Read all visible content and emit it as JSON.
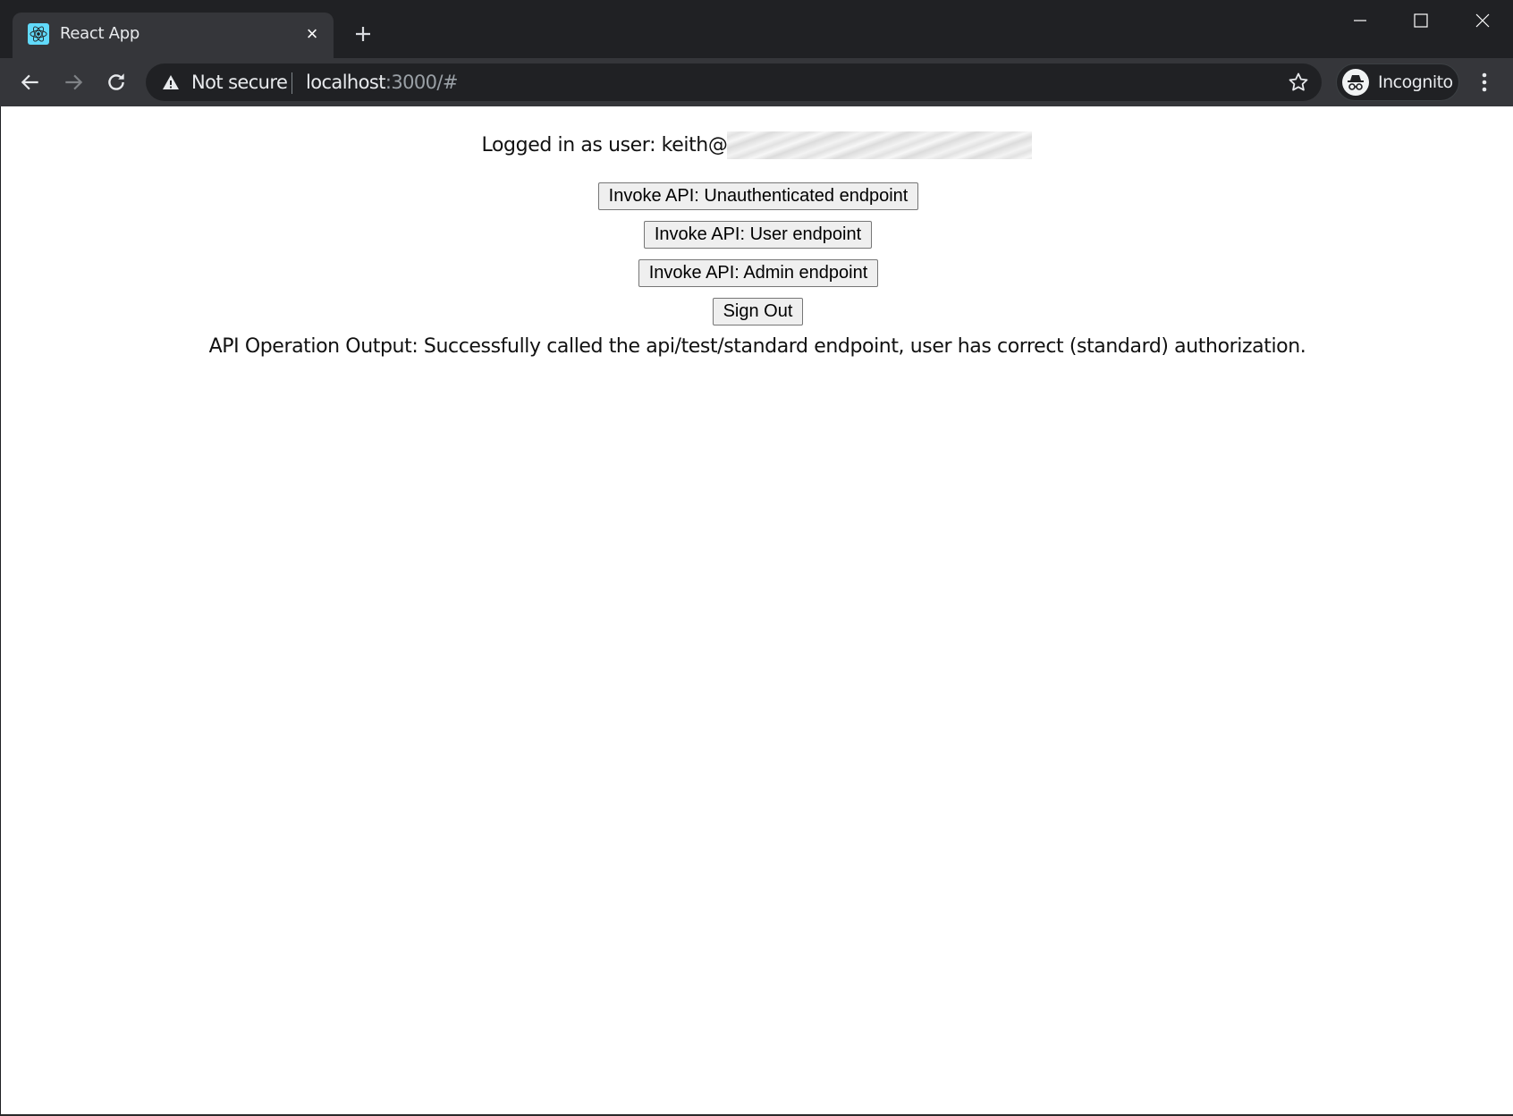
{
  "browser": {
    "tab": {
      "title": "React App",
      "favicon": "react-logo-icon",
      "close": "×"
    },
    "new_tab_icon": "plus-icon",
    "window_controls": [
      "minimize-icon",
      "maximize-icon",
      "close-icon"
    ],
    "nav": [
      "back-arrow-icon",
      "forward-arrow-icon",
      "reload-icon"
    ],
    "omnibox": {
      "security_label": "Not secure",
      "url_host": "localhost",
      "url_rest": ":3000/#"
    },
    "profile": {
      "label": "Incognito",
      "icon": "incognito-icon"
    },
    "colors": {
      "frame": "#202124",
      "toolbar": "#35363a",
      "favicon_bg": "#61dafb"
    }
  },
  "page": {
    "logged_in_prefix": "Logged in as user: keith@",
    "buttons": {
      "unauthenticated": "Invoke API: Unauthenticated endpoint",
      "user": "Invoke API: User endpoint",
      "admin": "Invoke API: Admin endpoint",
      "sign_out": "Sign Out"
    },
    "output": "API Operation Output: Successfully called the api/test/standard endpoint, user has correct (standard) authorization."
  }
}
